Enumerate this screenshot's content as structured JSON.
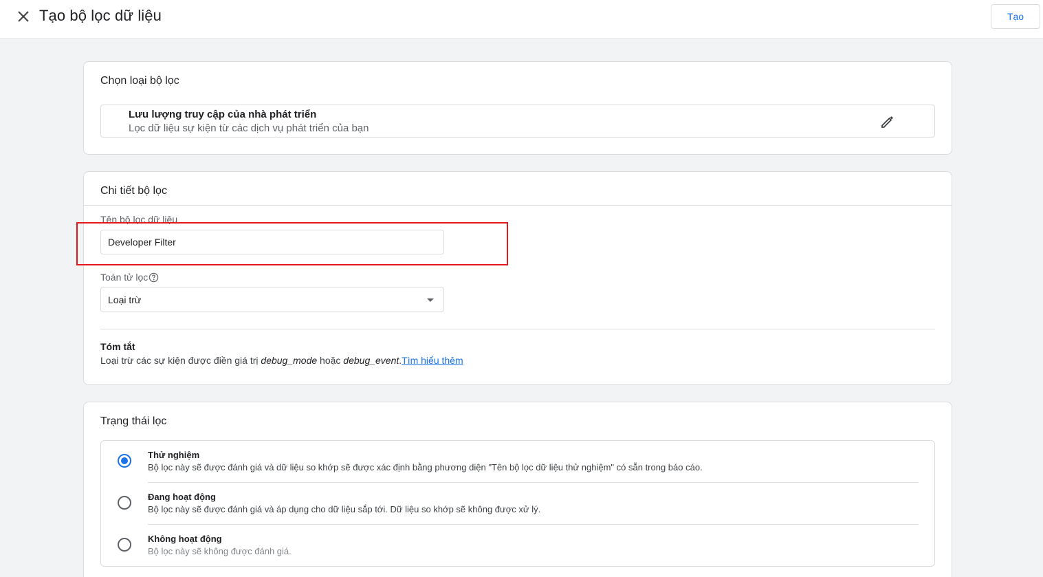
{
  "header": {
    "title": "Tạo bộ lọc dữ liệu",
    "create_label": "Tạo"
  },
  "filter_type_card": {
    "title": "Chọn loại bộ lọc",
    "type_name": "Lưu lượng truy cập của nhà phát triển",
    "type_description": "Lọc dữ liệu sự kiện từ các dịch vụ phát triển của bạn"
  },
  "details_card": {
    "title": "Chi tiết bộ lọc",
    "name_label": "Tên bộ lọc dữ liệu",
    "name_value": "Developer Filter",
    "operator_label": "Toán tử lọc",
    "operator_value": "Loại trừ",
    "summary_title": "Tóm tắt",
    "summary_prefix": "Loại trừ các sự kiện được điền giá trị ",
    "summary_param1": "debug_mode",
    "summary_middle": " hoặc ",
    "summary_param2": "debug_event",
    "summary_suffix": ".",
    "learn_more": "Tìm hiểu thêm"
  },
  "state_card": {
    "title": "Trạng thái lọc",
    "options": [
      {
        "name": "Thử nghiệm",
        "description": "Bộ lọc này sẽ được đánh giá và dữ liệu so khớp sẽ được xác định bằng phương diện \"Tên bộ lọc dữ liệu thử nghiệm\" có sẵn trong báo cáo.",
        "checked": true
      },
      {
        "name": "Đang hoạt động",
        "description": "Bộ lọc này sẽ được đánh giá và áp dụng cho dữ liệu sắp tới. Dữ liệu so khớp sẽ không được xử lý.",
        "checked": false
      },
      {
        "name": "Không hoạt động",
        "description": "Bộ lọc này sẽ không được đánh giá.",
        "checked": false
      }
    ]
  },
  "colors": {
    "accent": "#1a73e8",
    "highlight": "#e3181d",
    "background": "#f1f3f4"
  }
}
